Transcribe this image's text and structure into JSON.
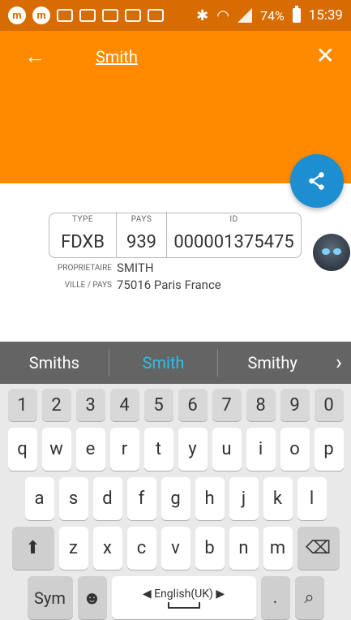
{
  "status_bar": {
    "time": "15:39",
    "battery": "74%",
    "icons": [
      "m-icon",
      "m-icon",
      "message-icon",
      "bell-icon",
      "voicemail-icon",
      "message-icon",
      "image-icon",
      "bluetooth-icon",
      "wifi-icon",
      "signal-icon",
      "battery-icon"
    ]
  },
  "header": {
    "title": "Smith",
    "accent_color": "#ff8a00"
  },
  "card": {
    "type_label": "TYPE",
    "type_value": "FDXB",
    "pays_label": "PAYS",
    "pays_value": "939",
    "id_label": "ID",
    "id_value": "000001375475",
    "owner_label": "PROPRIETAIRE",
    "owner_value": "SMITH",
    "city_label": "VILLE / PAYS",
    "city_value": "75016 Paris France"
  },
  "suggestions": [
    "Smiths",
    "Smith",
    "Smithy"
  ],
  "keyboard": {
    "numbers": [
      "1",
      "2",
      "3",
      "4",
      "5",
      "6",
      "7",
      "8",
      "9",
      "0"
    ],
    "row_q": [
      "q",
      "w",
      "e",
      "r",
      "t",
      "y",
      "u",
      "i",
      "o",
      "p"
    ],
    "row_a": [
      "a",
      "s",
      "d",
      "f",
      "g",
      "h",
      "j",
      "k",
      "l"
    ],
    "row_z": [
      "z",
      "x",
      "c",
      "v",
      "b",
      "n",
      "m"
    ],
    "sym_label": "Sym",
    "space_label": "◀ English(UK) ▶",
    "dot_label": "."
  }
}
